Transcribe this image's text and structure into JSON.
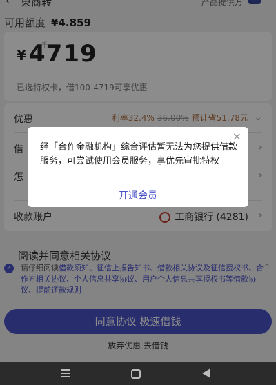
{
  "header": {
    "back_icon": "‹",
    "title": "東商转",
    "provider": "产品提供方"
  },
  "credit": {
    "label": "可用额度",
    "amount": "¥4.859"
  },
  "loan": {
    "unit_hint": "千",
    "currency": "¥",
    "amount": "4719",
    "hint": "已选特权卡，借100-4719可享优惠"
  },
  "discount": {
    "label": "优惠",
    "rate": "利率32.4%",
    "old_rate": "36.00%",
    "save": "预计省51.78元"
  },
  "rows": {
    "row2": "借",
    "row3": "怎",
    "account_label": "收款账户",
    "account_value": "工商银行 (4281)"
  },
  "agreement": {
    "title": "阅读并同意相关协议",
    "prefix": "请仔细阅读",
    "text1": "借款须知、征信上报告知书、借款相关协议及征信授权书、合作方相关协议、个人信息共享协议、用户个人信息共享授权书等借款协议、提前还款规则"
  },
  "cta_label": "同意协议 极速借钱",
  "giveup_label": "放弃优惠 去借钱",
  "dialog": {
    "message": "经「合作金融机构」综合评估暂无法为您提供借款服务，可尝试使用会员服务，享优先审批特权",
    "button": "开通会员",
    "close": "×"
  },
  "colors": {
    "accent": "#4a52c8",
    "discount": "#b06a3a"
  }
}
